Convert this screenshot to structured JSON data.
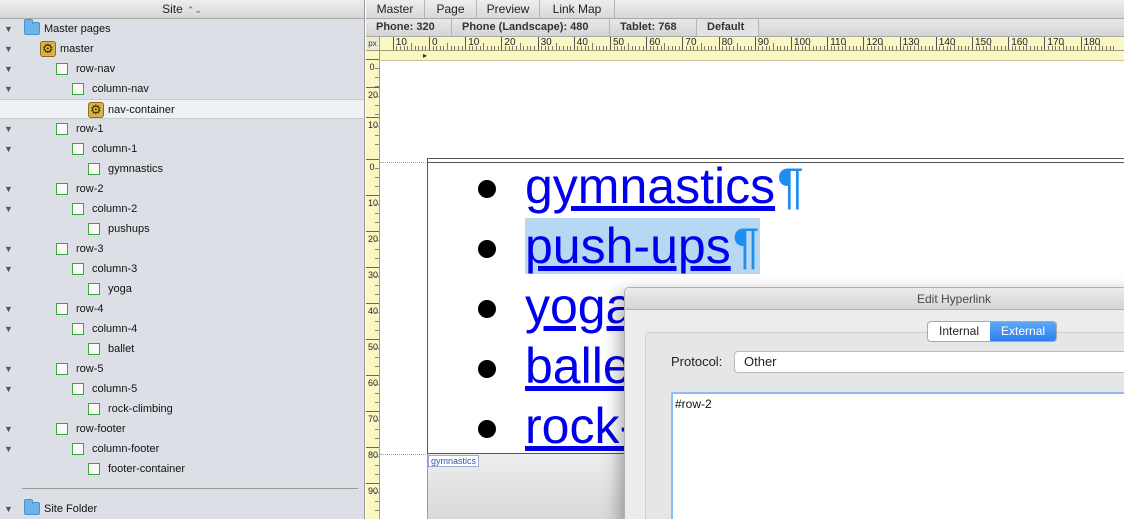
{
  "sidebar": {
    "header_title": "Site",
    "tree": [
      {
        "label": "Master pages",
        "indent": 0,
        "icon": "folder"
      },
      {
        "label": "master",
        "indent": 1,
        "icon": "master"
      },
      {
        "label": "row-nav",
        "indent": 2,
        "icon": "box"
      },
      {
        "label": "column-nav",
        "indent": 3,
        "icon": "box"
      },
      {
        "label": "nav-container",
        "indent": 4,
        "icon": "master",
        "selected": true
      },
      {
        "label": "row-1",
        "indent": 2,
        "icon": "box"
      },
      {
        "label": "column-1",
        "indent": 3,
        "icon": "box"
      },
      {
        "label": "gymnastics",
        "indent": 4,
        "icon": "box"
      },
      {
        "label": "row-2",
        "indent": 2,
        "icon": "box"
      },
      {
        "label": "column-2",
        "indent": 3,
        "icon": "box"
      },
      {
        "label": "pushups",
        "indent": 4,
        "icon": "box"
      },
      {
        "label": "row-3",
        "indent": 2,
        "icon": "box"
      },
      {
        "label": "column-3",
        "indent": 3,
        "icon": "box"
      },
      {
        "label": "yoga",
        "indent": 4,
        "icon": "box"
      },
      {
        "label": "row-4",
        "indent": 2,
        "icon": "box"
      },
      {
        "label": "column-4",
        "indent": 3,
        "icon": "box"
      },
      {
        "label": "ballet",
        "indent": 4,
        "icon": "box"
      },
      {
        "label": "row-5",
        "indent": 2,
        "icon": "box"
      },
      {
        "label": "column-5",
        "indent": 3,
        "icon": "box"
      },
      {
        "label": "rock-climbing",
        "indent": 4,
        "icon": "box"
      },
      {
        "label": "row-footer",
        "indent": 2,
        "icon": "box"
      },
      {
        "label": "column-footer",
        "indent": 3,
        "icon": "box"
      },
      {
        "label": "footer-container",
        "indent": 4,
        "icon": "box"
      }
    ],
    "site_folder": "Site Folder"
  },
  "tabs": [
    "Master",
    "Page",
    "Preview",
    "Link Map"
  ],
  "views": [
    "Phone: 320",
    "Phone (Landscape): 480",
    "Tablet: 768",
    "Default"
  ],
  "active_view": "Default",
  "ruler": {
    "unit": "px",
    "top_labels": [
      "10",
      "0",
      "10",
      "20",
      "30",
      "40",
      "50",
      "60",
      "70",
      "80",
      "90",
      "100",
      "110",
      "120",
      "130",
      "140",
      "150",
      "160",
      "170",
      "180"
    ],
    "left_labels": [
      "0",
      "20",
      "10",
      "0",
      "10",
      "20",
      "30",
      "40",
      "50",
      "60",
      "70",
      "80",
      "90"
    ]
  },
  "canvas": {
    "links": [
      {
        "text": "gymnastics",
        "highlighted": false
      },
      {
        "text": "push-ups",
        "highlighted": true
      },
      {
        "text": "yoga",
        "highlighted": false
      },
      {
        "text": "ballet",
        "highlighted": false
      },
      {
        "text": "rock-climbing",
        "highlighted": false
      }
    ],
    "pilcrow": "¶",
    "element_tag": "gymnastics"
  },
  "dialog": {
    "title": "Edit Hyperlink",
    "segments": [
      "Internal",
      "External"
    ],
    "active_segment": "External",
    "protocol_label": "Protocol:",
    "protocol_value": "Other",
    "url_value": "#row-2"
  },
  "colors": {
    "link": "#0000ee",
    "selection": "#b8d7f3",
    "pilcrow": "#1e8ff0",
    "tree_box": "#3aa63a",
    "segment_active": "#2d7ef1"
  }
}
